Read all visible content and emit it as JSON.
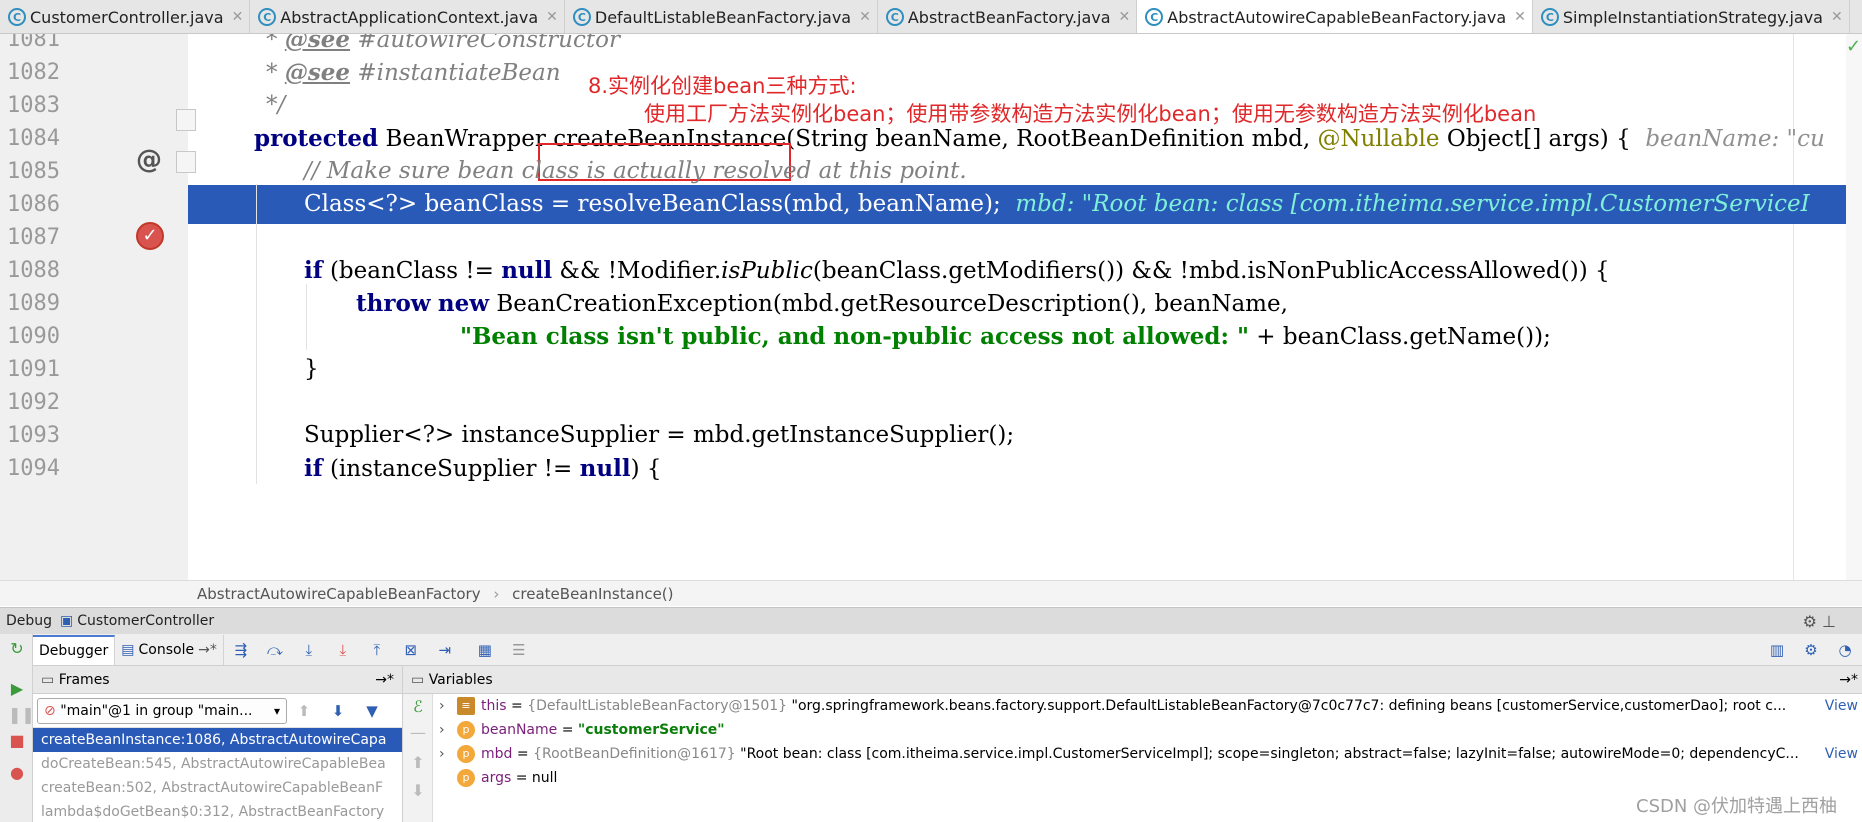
{
  "tabs": [
    {
      "label": "CustomerController.java",
      "active": false
    },
    {
      "label": "AbstractApplicationContext.java",
      "active": false
    },
    {
      "label": "DefaultListableBeanFactory.java",
      "active": false
    },
    {
      "label": "AbstractBeanFactory.java",
      "active": false
    },
    {
      "label": "AbstractAutowireCapableBeanFactory.java",
      "active": true
    },
    {
      "label": "SimpleInstantiationStrategy.java",
      "active": false
    }
  ],
  "editor": {
    "line_numbers": [
      "1081",
      "1082",
      "1083",
      "1084",
      "1085",
      "1086",
      "1087",
      "1088",
      "1089",
      "1090",
      "1091",
      "1092",
      "1093",
      "1094"
    ],
    "line_1081": {
      "star": "* ",
      "tag": "@see",
      "rest": " #autowireConstructor"
    },
    "line_1082": {
      "star": "* ",
      "tag": "@see",
      "rest": " #instantiateBean"
    },
    "line_1083": {
      "text": "*/"
    },
    "line_1084": {
      "kw": "protected",
      "type": " BeanWrapper ",
      "method": "createBeanInstance",
      "params_a": "(String beanName, RootBeanDefinition mbd, ",
      "nullable": "@Nullable",
      "params_b": " Object[] args) {",
      "hint": "beanName: \"cu"
    },
    "line_1085": {
      "comment": "// Make sure bean class is actually resolved at this point."
    },
    "line_1086": {
      "code": "Class<?> beanClass = resolveBeanClass(mbd, beanName);",
      "hint": "mbd: \"Root bean: class [com.itheima.service.impl.CustomerServiceI"
    },
    "line_1088": {
      "kw": "if",
      "a": " (beanClass != ",
      "null": "null",
      "b": " && !Modifier.",
      "isPublic": "isPublic",
      "c": "(beanClass.getModifiers()) && !mbd.isNonPublicAccessAllowed()) {"
    },
    "line_1089": {
      "throw": "throw",
      "new": "new",
      "rest": " BeanCreationException(mbd.getResourceDescription(), beanName,"
    },
    "line_1090": {
      "str": "\"Bean class isn't public, and non-public access not allowed: \"",
      "rest": " + beanClass.getName());"
    },
    "line_1091": {
      "text": "}"
    },
    "line_1093": {
      "text": "Supplier<?> instanceSupplier = mbd.getInstanceSupplier();"
    },
    "line_1094": {
      "kw": "if",
      "a": " (instanceSupplier != ",
      "null": "null",
      "b": ") {"
    },
    "annotation_title": "8.实例化创建bean三种方式:",
    "annotation_detail": "使用工厂方法实例化bean；使用带参数构造方法实例化bean；使用无参数构造方法实例化bean"
  },
  "breadcrumb": {
    "class": "AbstractAutowireCapableBeanFactory",
    "separator": "›",
    "method": "createBeanInstance()"
  },
  "debug": {
    "title": "Debug",
    "config": "CustomerController",
    "tabs": {
      "debugger": "Debugger",
      "console": "Console",
      "console_arrow": "→*"
    },
    "frames_title": "Frames",
    "variables_title": "Variables",
    "thread": "\"main\"@1 in group \"main...",
    "frames": [
      {
        "label": "createBeanInstance:1086, AbstractAutowireCapa",
        "selected": true
      },
      {
        "label": "doCreateBean:545, AbstractAutowireCapableBea",
        "selected": false
      },
      {
        "label": "createBean:502, AbstractAutowireCapableBeanF",
        "selected": false
      },
      {
        "label": "lambda$doGetBean$0:312, AbstractBeanFactory",
        "selected": false
      }
    ],
    "variables": [
      {
        "icon": "≡",
        "name": "this",
        "eq": " = ",
        "type": "{DefaultListableBeanFactory@1501} ",
        "value": "\"org.springframework.beans.factory.support.DefaultListableBeanFactory@7c0c77c7: defining beans [customerService,customerDao]; root c...",
        "view": "View"
      },
      {
        "icon": "p",
        "name": "beanName",
        "eq": " = ",
        "type": "",
        "value": "\"customerService\"",
        "view": ""
      },
      {
        "icon": "p",
        "name": "mbd",
        "eq": " = ",
        "type": "{RootBeanDefinition@1617} ",
        "value": "\"Root bean: class [com.itheima.service.impl.CustomerServiceImpl]; scope=singleton; abstract=false; lazyInit=false; autowireMode=0; dependencyC...",
        "view": "View"
      },
      {
        "icon": "p",
        "name": "args",
        "eq": " = ",
        "type": "",
        "value": "null",
        "view": ""
      }
    ]
  },
  "watermark": "CSDN @伏加特遇上西柚"
}
